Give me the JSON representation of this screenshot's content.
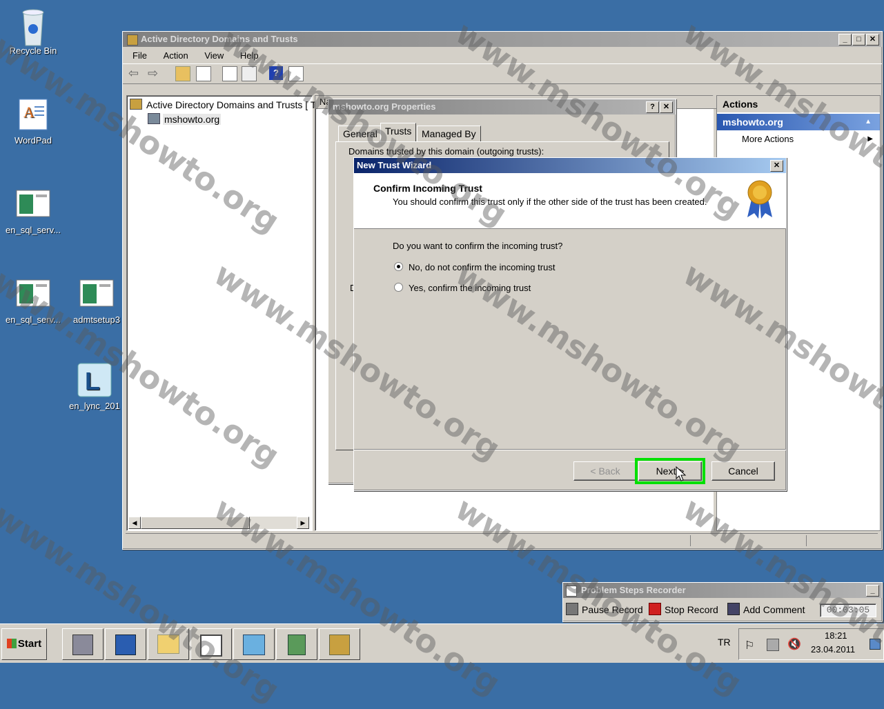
{
  "desktop_icons": [
    {
      "label": "Recycle Bin",
      "icon": "recycle-bin-icon"
    },
    {
      "label": "WordPad",
      "icon": "wordpad-icon"
    },
    {
      "label": "en_sql_serv...",
      "icon": "installer-icon"
    },
    {
      "label": "en_sql_serv...",
      "icon": "installer-icon"
    },
    {
      "label": "admtsetup3",
      "icon": "installer-icon"
    },
    {
      "label": "en_lync_201",
      "icon": "lync-icon"
    }
  ],
  "main_window": {
    "title": "Active Directory Domains and Trusts",
    "menu": [
      "File",
      "Action",
      "View",
      "Help"
    ],
    "tree": {
      "root": "Active Directory Domains and Trusts [ T",
      "child": "mshowto.org"
    },
    "list_header": "Na"
  },
  "actions_pane": {
    "header": "Actions",
    "section": "mshowto.org",
    "item": "More Actions"
  },
  "properties_dialog": {
    "title": "mshowto.org Properties",
    "tabs": [
      "General",
      "Trusts",
      "Managed By"
    ],
    "active_tab": "Trusts",
    "outgoing_label": "Domains trusted by this domain (outgoing trusts):",
    "fragment": "D"
  },
  "wizard": {
    "title": "New Trust Wizard",
    "heading": "Confirm Incoming Trust",
    "subheading": "You should confirm this trust only if the other side of the trust has been created.",
    "question": "Do you want to confirm the incoming trust?",
    "options": [
      {
        "label": "No, do not confirm the incoming trust",
        "selected": true
      },
      {
        "label": "Yes, confirm the incoming trust",
        "selected": false
      }
    ],
    "back_label": "< Back",
    "next_label": "Next >",
    "cancel_label": "Cancel",
    "highlight_color": "#00e000"
  },
  "psr": {
    "title": "Problem Steps Recorder",
    "pause_label": "Pause Record",
    "stop_label": "Stop Record",
    "comment_label": "Add Comment",
    "timer": "00:03:05"
  },
  "taskbar": {
    "start_label": "Start",
    "language": "TR",
    "time": "18:21",
    "date": "23.04.2011"
  },
  "watermark": "www.mshowto.org"
}
